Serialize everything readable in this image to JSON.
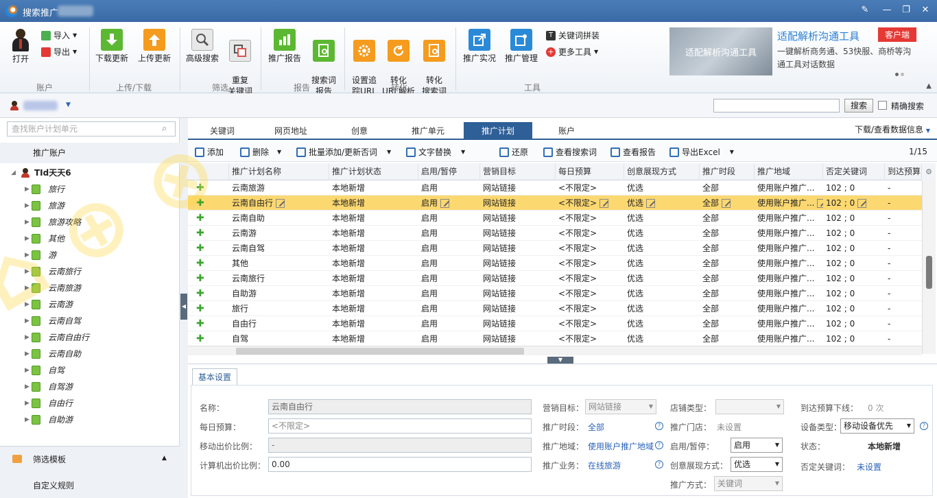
{
  "window": {
    "title": "搜索推广"
  },
  "ribbon": {
    "open": "打开",
    "import": "导入",
    "export": "导出",
    "download_update": "下载更新",
    "upload_update": "上传更新",
    "advanced_search": "高级搜索",
    "duplicate_keywords": "重复\n关键词",
    "promo_report": "推广报告",
    "search_term_report": "搜索词\n报告",
    "set_tracking_url": "设置追\n踪URL",
    "conv_url_parse": "转化\nURL解析",
    "conv_search_term": "转化\n搜索词",
    "promo_live": "推广实况",
    "promo_manage": "推广管理",
    "keyword_combine": "关键词拼装",
    "more_tools": "更多工具",
    "groups": [
      "账户",
      "上传/下载",
      "筛选",
      "报告",
      "转化",
      "工具"
    ],
    "ad": {
      "image_text": "适配解析沟通工具",
      "title": "适配解析沟通工具",
      "tag": "客户端",
      "desc": "一键解析商务通、53快服、商桥等沟通工具对话数据"
    }
  },
  "accountbar": {
    "search_button": "搜索",
    "exact_search": "精确搜索"
  },
  "left": {
    "search_placeholder": "查找账户计划单元",
    "header": "推广账户",
    "root": "TId天天6",
    "items": [
      "旅行",
      "旅游",
      "旅游攻略",
      "其他",
      "游",
      "云南旅行",
      "云南旅游",
      "云南游",
      "云南自驾",
      "云南自由行",
      "云南自助",
      "自驾",
      "自驾游",
      "自由行",
      "自助游"
    ],
    "filter_template": "筛选模板",
    "custom_rule": "自定义规则"
  },
  "tabs": {
    "items": [
      "关键词",
      "网页地址",
      "创意",
      "推广单元",
      "推广计划",
      "账户"
    ],
    "active": "推广计划",
    "download_view": "下载/查看数据信息"
  },
  "toolbar": {
    "add": "添加",
    "delete": "删除",
    "batch_add": "批量添加/更新否词",
    "text_replace": "文字替换",
    "restore": "还原",
    "view_search_terms": "查看搜索词",
    "view_report": "查看报告",
    "export_excel": "导出Excel",
    "page": "1/15"
  },
  "grid": {
    "columns": [
      "推广计划名称",
      "推广计划状态",
      "启用/暂停",
      "营销目标",
      "每日预算",
      "创意展现方式",
      "推广时段",
      "推广地域",
      "否定关键词",
      "到达预算"
    ],
    "rows": [
      [
        "云南旅游",
        "本地新增",
        "启用",
        "网站链接",
        "<不限定>",
        "优选",
        "全部",
        "使用账户推广...",
        "102 ; 0",
        "-"
      ],
      [
        "云南自由行",
        "本地新增",
        "启用",
        "网站链接",
        "<不限定>",
        "优选",
        "全部",
        "使用账户推广...",
        "102 ; 0",
        "-"
      ],
      [
        "云南自助",
        "本地新增",
        "启用",
        "网站链接",
        "<不限定>",
        "优选",
        "全部",
        "使用账户推广...",
        "102 ; 0",
        "-"
      ],
      [
        "云南游",
        "本地新增",
        "启用",
        "网站链接",
        "<不限定>",
        "优选",
        "全部",
        "使用账户推广...",
        "102 ; 0",
        "-"
      ],
      [
        "云南自驾",
        "本地新增",
        "启用",
        "网站链接",
        "<不限定>",
        "优选",
        "全部",
        "使用账户推广...",
        "102 ; 0",
        "-"
      ],
      [
        "其他",
        "本地新增",
        "启用",
        "网站链接",
        "<不限定>",
        "优选",
        "全部",
        "使用账户推广...",
        "102 ; 0",
        "-"
      ],
      [
        "云南旅行",
        "本地新增",
        "启用",
        "网站链接",
        "<不限定>",
        "优选",
        "全部",
        "使用账户推广...",
        "102 ; 0",
        "-"
      ],
      [
        "自助游",
        "本地新增",
        "启用",
        "网站链接",
        "<不限定>",
        "优选",
        "全部",
        "使用账户推广...",
        "102 ; 0",
        "-"
      ],
      [
        "旅行",
        "本地新增",
        "启用",
        "网站链接",
        "<不限定>",
        "优选",
        "全部",
        "使用账户推广...",
        "102 ; 0",
        "-"
      ],
      [
        "自由行",
        "本地新增",
        "启用",
        "网站链接",
        "<不限定>",
        "优选",
        "全部",
        "使用账户推广...",
        "102 ; 0",
        "-"
      ],
      [
        "自驾",
        "本地新增",
        "启用",
        "网站链接",
        "<不限定>",
        "优选",
        "全部",
        "使用账户推广...",
        "102 ; 0",
        "-"
      ]
    ],
    "selected_row": 1
  },
  "props": {
    "tab": "基本设置",
    "name_label": "名称：",
    "name_value": "云南自由行",
    "daily_budget_label": "每日预算：",
    "daily_budget_value": "<不限定>",
    "mobile_ratio_label": "移动出价比例：",
    "mobile_ratio_value": "-",
    "pc_ratio_label": "计算机出价比例：",
    "pc_ratio_value": "0.00",
    "marketing_goal_label": "营销目标：",
    "marketing_goal_value": "网站链接",
    "promo_time_label": "推广时段：",
    "promo_time_value": "全部",
    "promo_region_label": "推广地域：",
    "promo_region_value": "使用账户推广地域",
    "promo_business_label": "推广业务：",
    "promo_business_value": "在线旅游",
    "shop_type_label": "店铺类型：",
    "shop_value_label": "推广门店：",
    "shop_value": "未设置",
    "enable_label": "启用/暂停：",
    "enable_value": "启用",
    "creative_label": "创意展现方式：",
    "creative_value": "优选",
    "promo_method_label": "推广方式：",
    "promo_method_value": "关键词",
    "reach_budget_label": "到达预算下线：",
    "reach_budget_value": "0 次",
    "device_label": "设备类型：",
    "device_value": "移动设备优先",
    "status_label": "状态：",
    "status_value": "本地新增",
    "neg_kw_label": "否定关键词：",
    "neg_kw_value": "未设置"
  }
}
